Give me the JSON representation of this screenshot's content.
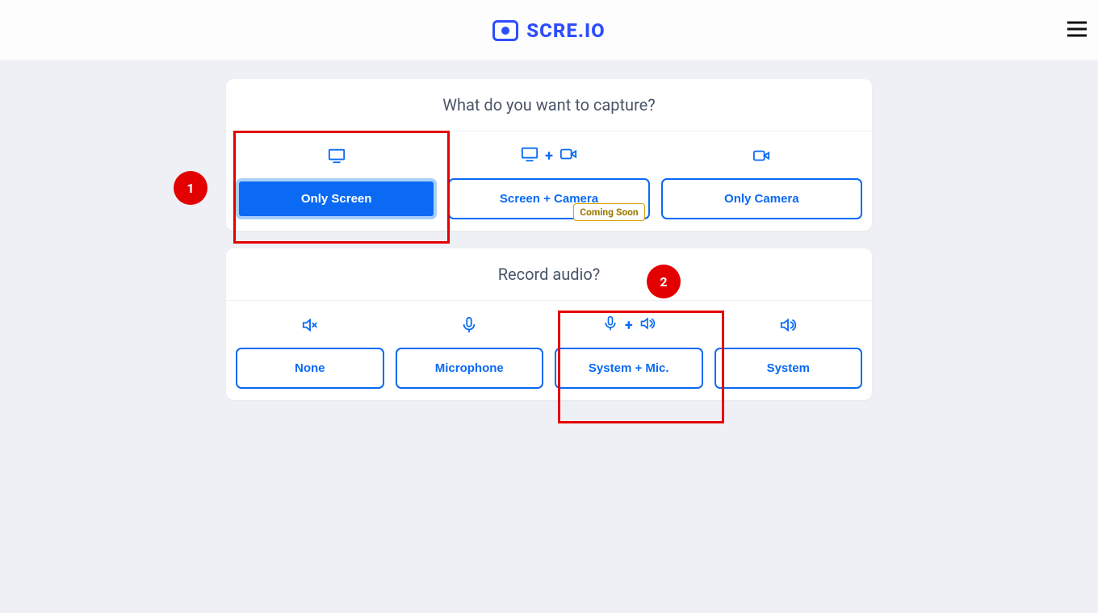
{
  "header": {
    "brand": "SCRE.IO"
  },
  "capture": {
    "title": "What do you want to capture?",
    "options": [
      {
        "label": "Only Screen",
        "selected": true
      },
      {
        "label": "Screen + Camera",
        "selected": false,
        "badge": "Coming Soon"
      },
      {
        "label": "Only Camera",
        "selected": false
      }
    ]
  },
  "audio": {
    "title": "Record audio?",
    "options": [
      {
        "label": "None"
      },
      {
        "label": "Microphone"
      },
      {
        "label": "System + Mic."
      },
      {
        "label": "System"
      }
    ]
  },
  "annotations": {
    "step1": "1",
    "step2": "2"
  }
}
